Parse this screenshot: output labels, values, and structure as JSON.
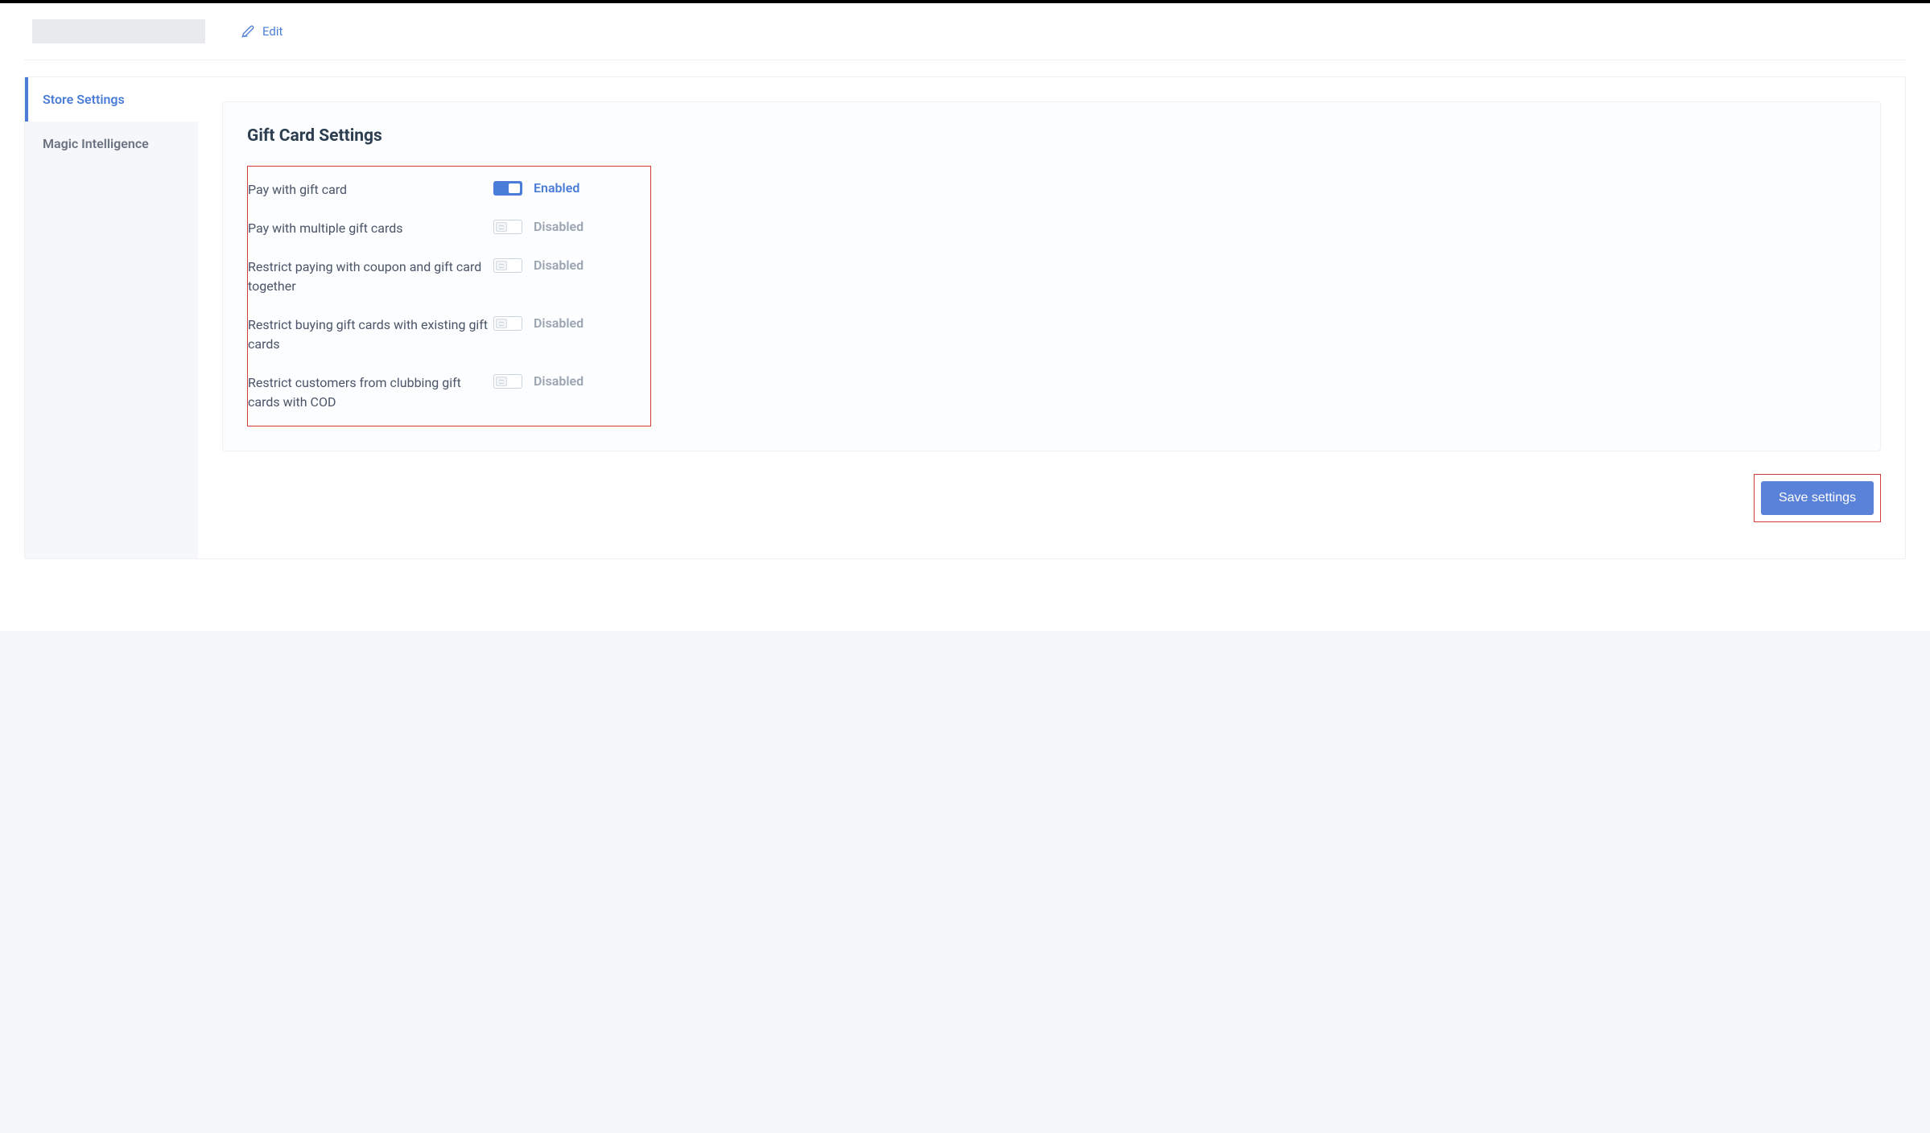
{
  "header": {
    "edit_label": "Edit"
  },
  "sidebar": {
    "items": [
      {
        "label": "Store Settings",
        "active": true
      },
      {
        "label": "Magic Intelligence",
        "active": false
      }
    ]
  },
  "panel": {
    "title": "Gift Card Settings",
    "labels": {
      "enabled": "Enabled",
      "disabled": "Disabled"
    },
    "settings": [
      {
        "label": "Pay with gift card",
        "enabled": true
      },
      {
        "label": "Pay with multiple gift cards",
        "enabled": false
      },
      {
        "label": "Restrict paying with coupon and gift card together",
        "enabled": false
      },
      {
        "label": "Restrict buying gift cards with existing gift cards",
        "enabled": false
      },
      {
        "label": "Restrict customers from clubbing gift cards with COD",
        "enabled": false
      }
    ]
  },
  "actions": {
    "save_label": "Save settings"
  }
}
